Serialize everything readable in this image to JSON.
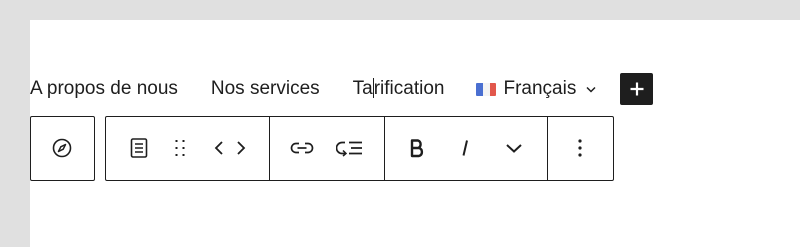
{
  "navigation": {
    "items": [
      {
        "label": "A propos de nous"
      },
      {
        "label": "Nos services"
      },
      {
        "label_before_caret": "Ta",
        "label_after_caret": "rification"
      }
    ]
  },
  "language_switcher": {
    "label": "Français",
    "flag_colors": [
      "#0055a4",
      "#ffffff",
      "#ef4135"
    ],
    "icon": "chevron-down-icon"
  },
  "add_block": {
    "icon": "plus-icon"
  },
  "block_toolbar": {
    "groups": [
      {
        "buttons": [
          {
            "icon": "compass-icon"
          }
        ]
      },
      {
        "buttons": [
          {
            "icon": "page-list-icon"
          },
          {
            "icon": "drag-handle-icon"
          },
          {
            "icon": "move-arrows-icon"
          }
        ]
      },
      {
        "buttons": [
          {
            "icon": "link-icon"
          },
          {
            "icon": "submenu-icon"
          }
        ]
      },
      {
        "buttons": [
          {
            "icon": "bold-icon"
          },
          {
            "icon": "italic-icon"
          },
          {
            "icon": "chevron-down-icon"
          }
        ]
      },
      {
        "buttons": [
          {
            "icon": "more-options-icon"
          }
        ]
      }
    ]
  },
  "colors": {
    "text": "#1e1e1e",
    "frame": "#e0e0e0",
    "background": "#ffffff"
  }
}
